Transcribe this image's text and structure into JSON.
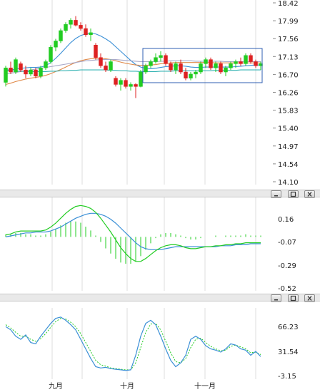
{
  "colors": {
    "up": "#22cc22",
    "down": "#dd2222",
    "ma_blue": "#3a8fd6",
    "ma_orange": "#e08a4a",
    "ma_gray": "#a8a8c8",
    "ma_teal": "#33b3b3",
    "macd_diff": "#22cc22",
    "macd_dea": "#3a8fd6",
    "kd_k": "#3a8fd6",
    "kd_d": "#22cc22",
    "selection": "#2f5fb3",
    "grid": "#dddddd"
  },
  "icons": {
    "minimize": "minimize-icon",
    "restore": "restore-icon",
    "close": "close-icon"
  },
  "chart_data": [
    {
      "type": "candlestick",
      "y_ticks": [
        "18.42",
        "17.99",
        "17.56",
        "17.13",
        "16.70",
        "16.26",
        "15.83",
        "15.40",
        "14.97",
        "14.54",
        "14.10"
      ],
      "ylim": [
        14.1,
        18.42
      ],
      "x_ticks": [
        "九月",
        "十月",
        "十一月"
      ],
      "candles": [
        [
          16.5,
          16.9,
          16.4,
          16.85
        ],
        [
          16.85,
          17.0,
          16.7,
          16.75
        ],
        [
          16.75,
          17.1,
          16.7,
          17.05
        ],
        [
          16.95,
          17.0,
          16.75,
          16.8
        ],
        [
          16.8,
          16.9,
          16.6,
          16.7
        ],
        [
          16.7,
          16.85,
          16.65,
          16.8
        ],
        [
          16.8,
          16.85,
          16.6,
          16.65
        ],
        [
          16.65,
          16.9,
          16.6,
          16.85
        ],
        [
          16.85,
          17.05,
          16.8,
          17.0
        ],
        [
          17.0,
          17.4,
          16.95,
          17.35
        ],
        [
          17.35,
          17.55,
          17.25,
          17.5
        ],
        [
          17.5,
          17.8,
          17.45,
          17.75
        ],
        [
          17.75,
          17.95,
          17.7,
          17.9
        ],
        [
          17.9,
          18.05,
          17.8,
          18.0
        ],
        [
          18.0,
          18.1,
          17.85,
          17.88
        ],
        [
          17.88,
          17.95,
          17.75,
          17.8
        ],
        [
          17.8,
          17.9,
          17.6,
          17.65
        ],
        [
          17.65,
          17.8,
          17.5,
          17.7
        ],
        [
          17.4,
          17.45,
          17.05,
          17.1
        ],
        [
          17.1,
          17.2,
          16.85,
          16.9
        ],
        [
          16.9,
          17.0,
          16.75,
          16.8
        ],
        [
          16.8,
          17.05,
          16.75,
          17.0
        ],
        [
          16.6,
          16.65,
          16.4,
          16.45
        ],
        [
          16.45,
          16.6,
          16.3,
          16.55
        ],
        [
          16.55,
          16.6,
          16.35,
          16.4
        ],
        [
          16.4,
          16.5,
          16.3,
          16.45
        ],
        [
          16.45,
          16.48,
          16.12,
          16.4
        ],
        [
          16.4,
          16.8,
          16.38,
          16.75
        ],
        [
          16.75,
          16.95,
          16.7,
          16.9
        ],
        [
          16.9,
          17.05,
          16.85,
          17.0
        ],
        [
          17.0,
          17.2,
          16.95,
          17.1
        ],
        [
          17.1,
          17.25,
          17.0,
          17.15
        ],
        [
          17.15,
          17.2,
          16.9,
          16.95
        ],
        [
          16.95,
          17.0,
          16.75,
          16.8
        ],
        [
          16.8,
          17.0,
          16.7,
          16.95
        ],
        [
          16.95,
          17.05,
          16.7,
          16.75
        ],
        [
          16.75,
          16.85,
          16.55,
          16.6
        ],
        [
          16.6,
          16.75,
          16.55,
          16.7
        ],
        [
          16.7,
          16.8,
          16.6,
          16.75
        ],
        [
          16.75,
          17.0,
          16.7,
          16.95
        ],
        [
          16.95,
          17.1,
          16.85,
          17.05
        ],
        [
          17.05,
          17.1,
          16.8,
          16.85
        ],
        [
          16.85,
          17.0,
          16.75,
          16.95
        ],
        [
          16.95,
          17.0,
          16.7,
          16.75
        ],
        [
          16.75,
          16.9,
          16.65,
          16.85
        ],
        [
          16.85,
          17.0,
          16.8,
          16.95
        ],
        [
          16.95,
          17.05,
          16.85,
          17.0
        ],
        [
          17.0,
          17.1,
          16.9,
          16.95
        ],
        [
          16.95,
          17.2,
          16.9,
          17.15
        ],
        [
          17.15,
          17.2,
          16.95,
          17.0
        ],
        [
          17.0,
          17.05,
          16.85,
          16.9
        ],
        [
          16.9,
          17.0,
          16.8,
          16.95
        ]
      ],
      "ma_series": [
        {
          "color_key": "ma_blue",
          "values": [
            16.8,
            16.8,
            16.82,
            16.84,
            16.85,
            16.86,
            16.86,
            16.87,
            16.9,
            16.98,
            17.08,
            17.2,
            17.33,
            17.46,
            17.56,
            17.63,
            17.67,
            17.69,
            17.67,
            17.62,
            17.55,
            17.47,
            17.36,
            17.25,
            17.14,
            17.03,
            16.93,
            16.87,
            16.84,
            16.83,
            16.84,
            16.86,
            16.88,
            16.89,
            16.9,
            16.9,
            16.89,
            16.87,
            16.86,
            16.86,
            16.87,
            16.87,
            16.87,
            16.87,
            16.87,
            16.87,
            16.88,
            16.89,
            16.9,
            16.91,
            16.92,
            16.92
          ]
        },
        {
          "color_key": "ma_orange",
          "values": [
            16.45,
            16.48,
            16.52,
            16.55,
            16.58,
            16.6,
            16.62,
            16.64,
            16.67,
            16.71,
            16.76,
            16.81,
            16.87,
            16.93,
            16.98,
            17.02,
            17.05,
            17.07,
            17.08,
            17.08,
            17.07,
            17.05,
            17.02,
            16.99,
            16.96,
            16.94,
            16.92,
            16.91,
            16.91,
            16.92,
            16.93,
            16.95,
            16.96,
            16.97,
            16.98,
            16.98,
            16.98,
            16.98,
            16.98,
            16.98,
            16.98,
            16.98,
            16.97,
            16.97,
            16.97,
            16.97,
            16.97,
            16.97,
            16.97,
            16.97,
            16.97,
            16.97
          ]
        },
        {
          "color_key": "ma_gray",
          "values": [
            16.7,
            16.72,
            16.74,
            16.76,
            16.78,
            16.8,
            16.82,
            16.84,
            16.86,
            16.88,
            16.9,
            16.92,
            16.94,
            16.96,
            16.98,
            17.0,
            17.02,
            17.03,
            17.04,
            17.05,
            17.05,
            17.05,
            17.05,
            17.04,
            17.03,
            17.02,
            17.01,
            17.0,
            17.0,
            17.0,
            17.0,
            17.01,
            17.01,
            17.02,
            17.02,
            17.02,
            17.02,
            17.02,
            17.01,
            17.01,
            17.01,
            17.01,
            17.01,
            17.01,
            17.0,
            17.0,
            17.0,
            17.0,
            17.0,
            17.0,
            17.0,
            17.0
          ]
        },
        {
          "color_key": "ma_teal",
          "values": [
            16.78,
            16.78,
            16.77,
            16.77,
            16.76,
            16.76,
            16.76,
            16.76,
            16.76,
            16.77,
            16.77,
            16.78,
            16.78,
            16.79,
            16.79,
            16.8,
            16.8,
            16.8,
            16.8,
            16.8,
            16.8,
            16.79,
            16.79,
            16.78,
            16.78,
            16.77,
            16.77,
            16.76,
            16.76,
            16.76,
            16.76,
            16.77,
            16.77,
            16.77,
            16.78,
            16.78,
            16.78,
            16.78,
            16.78,
            16.78,
            16.78,
            16.78,
            16.79,
            16.79,
            16.79,
            16.79,
            16.79,
            16.8,
            16.8,
            16.8,
            16.8,
            16.8
          ]
        }
      ]
    },
    {
      "type": "macd",
      "y_ticks": [
        "0.16",
        "-0.07",
        "-0.29",
        "-0.52"
      ],
      "ylim": [
        -0.52,
        0.38
      ],
      "diff": [
        0.02,
        0.03,
        0.05,
        0.06,
        0.06,
        0.06,
        0.06,
        0.06,
        0.07,
        0.1,
        0.14,
        0.19,
        0.24,
        0.28,
        0.31,
        0.32,
        0.31,
        0.29,
        0.25,
        0.19,
        0.12,
        0.05,
        -0.03,
        -0.11,
        -0.17,
        -0.22,
        -0.25,
        -0.25,
        -0.22,
        -0.18,
        -0.14,
        -0.11,
        -0.09,
        -0.08,
        -0.08,
        -0.09,
        -0.11,
        -0.12,
        -0.12,
        -0.11,
        -0.1,
        -0.1,
        -0.09,
        -0.09,
        -0.08,
        -0.08,
        -0.07,
        -0.07,
        -0.06,
        -0.06,
        -0.06,
        -0.06
      ],
      "dea": [
        0.0,
        0.01,
        0.02,
        0.03,
        0.04,
        0.04,
        0.05,
        0.05,
        0.05,
        0.06,
        0.08,
        0.1,
        0.13,
        0.16,
        0.19,
        0.21,
        0.23,
        0.24,
        0.24,
        0.23,
        0.21,
        0.18,
        0.14,
        0.09,
        0.04,
        -0.01,
        -0.06,
        -0.1,
        -0.12,
        -0.13,
        -0.13,
        -0.13,
        -0.12,
        -0.11,
        -0.1,
        -0.1,
        -0.1,
        -0.1,
        -0.1,
        -0.1,
        -0.1,
        -0.1,
        -0.1,
        -0.09,
        -0.09,
        -0.09,
        -0.08,
        -0.08,
        -0.08,
        -0.07,
        -0.07,
        -0.07
      ]
    },
    {
      "type": "kd",
      "y_ticks": [
        "66.23",
        "31.54",
        "-3.15"
      ],
      "ylim": [
        -3.15,
        100
      ],
      "k": [
        75,
        70,
        60,
        55,
        62,
        50,
        48,
        60,
        70,
        80,
        88,
        90,
        85,
        78,
        70,
        55,
        40,
        25,
        12,
        10,
        11,
        9,
        8,
        7,
        6,
        7,
        30,
        60,
        80,
        85,
        78,
        60,
        40,
        22,
        12,
        18,
        30,
        55,
        60,
        55,
        45,
        40,
        38,
        35,
        40,
        48,
        46,
        40,
        38,
        30,
        36,
        28
      ],
      "d": [
        78,
        73,
        66,
        60,
        60,
        55,
        52,
        56,
        64,
        74,
        83,
        88,
        87,
        82,
        75,
        64,
        50,
        36,
        22,
        15,
        13,
        10,
        9,
        8,
        7,
        7,
        18,
        42,
        66,
        79,
        80,
        70,
        52,
        34,
        20,
        18,
        25,
        42,
        55,
        57,
        50,
        44,
        40,
        37,
        38,
        44,
        46,
        43,
        40,
        34,
        35,
        31
      ]
    }
  ]
}
